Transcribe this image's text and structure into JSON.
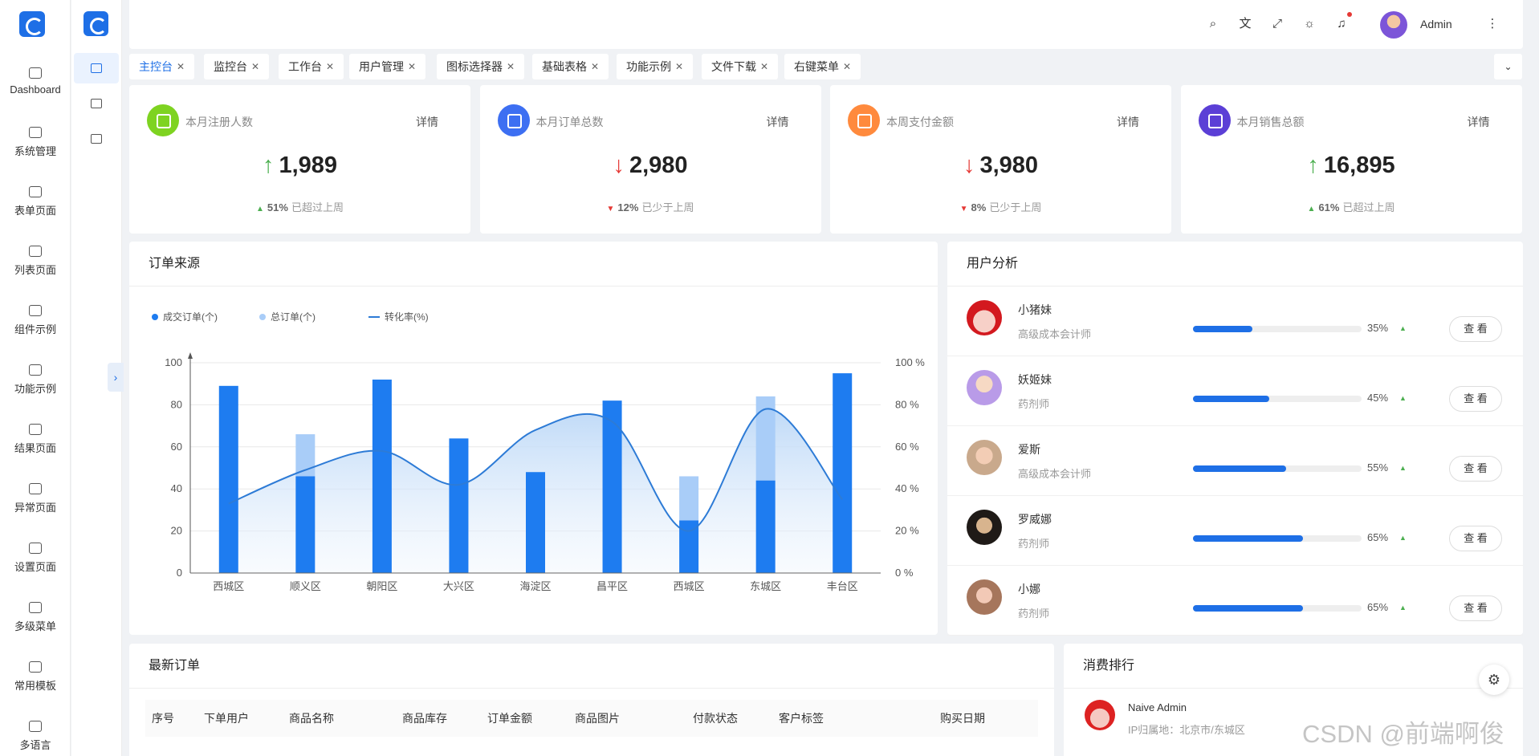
{
  "rail": {
    "items": [
      {
        "label": "Dashboard",
        "icon": "dashboard-icon"
      },
      {
        "label": "系统管理",
        "icon": "settings-icon"
      },
      {
        "label": "表单页面",
        "icon": "form-icon"
      },
      {
        "label": "列表页面",
        "icon": "list-icon"
      },
      {
        "label": "组件示例",
        "icon": "component-icon"
      },
      {
        "label": "功能示例",
        "icon": "feature-icon"
      },
      {
        "label": "结果页面",
        "icon": "result-icon"
      },
      {
        "label": "异常页面",
        "icon": "error-icon"
      },
      {
        "label": "设置页面",
        "icon": "settings-icon"
      },
      {
        "label": "多级菜单",
        "icon": "menu-icon"
      },
      {
        "label": "常用模板",
        "icon": "template-icon"
      },
      {
        "label": "多语言",
        "icon": "language-icon"
      }
    ]
  },
  "topbar": {
    "icons": [
      "search-icon",
      "translate-icon",
      "fullscreen-icon",
      "theme-icon",
      "bell-icon",
      "more-icon"
    ],
    "user": "Admin"
  },
  "tabs": [
    {
      "label": "主控台",
      "active": true
    },
    {
      "label": "监控台"
    },
    {
      "label": "工作台"
    },
    {
      "label": "用户管理"
    },
    {
      "label": "图标选择器"
    },
    {
      "label": "基础表格"
    },
    {
      "label": "功能示例"
    },
    {
      "label": "文件下载"
    },
    {
      "label": "右键菜单"
    }
  ],
  "stats": [
    {
      "title": "本月注册人数",
      "link": "详情",
      "value": "1,989",
      "trend": "up",
      "percent": "51%",
      "note": "已超过上周",
      "color": "#7ed321"
    },
    {
      "title": "本月订单总数",
      "link": "详情",
      "value": "2,980",
      "trend": "down",
      "percent": "12%",
      "note": "已少于上周",
      "color": "#3d6ff2"
    },
    {
      "title": "本周支付金额",
      "link": "详情",
      "value": "3,980",
      "trend": "down",
      "percent": "8%",
      "note": "已少于上周",
      "color": "#ff8a3d"
    },
    {
      "title": "本月销售总额",
      "link": "详情",
      "value": "16,895",
      "trend": "up",
      "percent": "61%",
      "note": "已超过上周",
      "color": "#5b3fd6"
    }
  ],
  "order_source": {
    "title": "订单来源",
    "legend": [
      "成交订单(个)",
      "总订单(个)",
      "转化率(%)"
    ]
  },
  "chart_data": {
    "type": "bar",
    "categories": [
      "西城区",
      "顺义区",
      "朝阳区",
      "大兴区",
      "海淀区",
      "昌平区",
      "西城区",
      "东城区",
      "丰台区"
    ],
    "series": [
      {
        "name": "成交订单(个)",
        "type": "bar",
        "values": [
          89,
          46,
          92,
          64,
          48,
          82,
          25,
          44,
          95
        ],
        "color": "#1e7cf0"
      },
      {
        "name": "总订单(个)",
        "type": "bar",
        "values": [
          89,
          66,
          92,
          64,
          48,
          82,
          46,
          84,
          95
        ],
        "color": "#a9cdf8"
      },
      {
        "name": "转化率(%)",
        "type": "line",
        "area": true,
        "values": [
          33,
          49,
          58,
          42,
          68,
          72,
          20,
          78,
          35
        ],
        "color": "#2d7bd6"
      }
    ],
    "y_left": {
      "ylim": [
        0,
        100
      ],
      "ticks": [
        "0",
        "20",
        "40",
        "60",
        "80",
        "100"
      ]
    },
    "y_right": {
      "ylim": [
        0,
        100
      ],
      "ticks": [
        "0 %",
        "20 %",
        "40 %",
        "60 %",
        "80 %",
        "100 %"
      ]
    },
    "grid": true,
    "legend_position": "top-left"
  },
  "user_analysis": {
    "title": "用户分析",
    "button_label": "查 看",
    "users": [
      {
        "name": "小猪妹",
        "role": "高级成本会计师",
        "progress": 35,
        "percent": "35%"
      },
      {
        "name": "妖姬妹",
        "role": "药剂师",
        "progress": 45,
        "percent": "45%"
      },
      {
        "name": "爱斯",
        "role": "高级成本会计师",
        "progress": 55,
        "percent": "55%"
      },
      {
        "name": "罗威娜",
        "role": "药剂师",
        "progress": 65,
        "percent": "65%"
      },
      {
        "name": "小娜",
        "role": "药剂师",
        "progress": 65,
        "percent": "65%"
      }
    ]
  },
  "latest_orders": {
    "title": "最新订单",
    "columns": [
      "序号",
      "下单用户",
      "商品名称",
      "商品库存",
      "订单金额",
      "商品图片",
      "付款状态",
      "客户标签",
      "购买日期"
    ]
  },
  "ranking": {
    "title": "消费排行",
    "items": [
      {
        "name": "Naive Admin",
        "location": "IP归属地：北京市/东城区"
      }
    ]
  },
  "watermark": "CSDN @前端啊俊"
}
